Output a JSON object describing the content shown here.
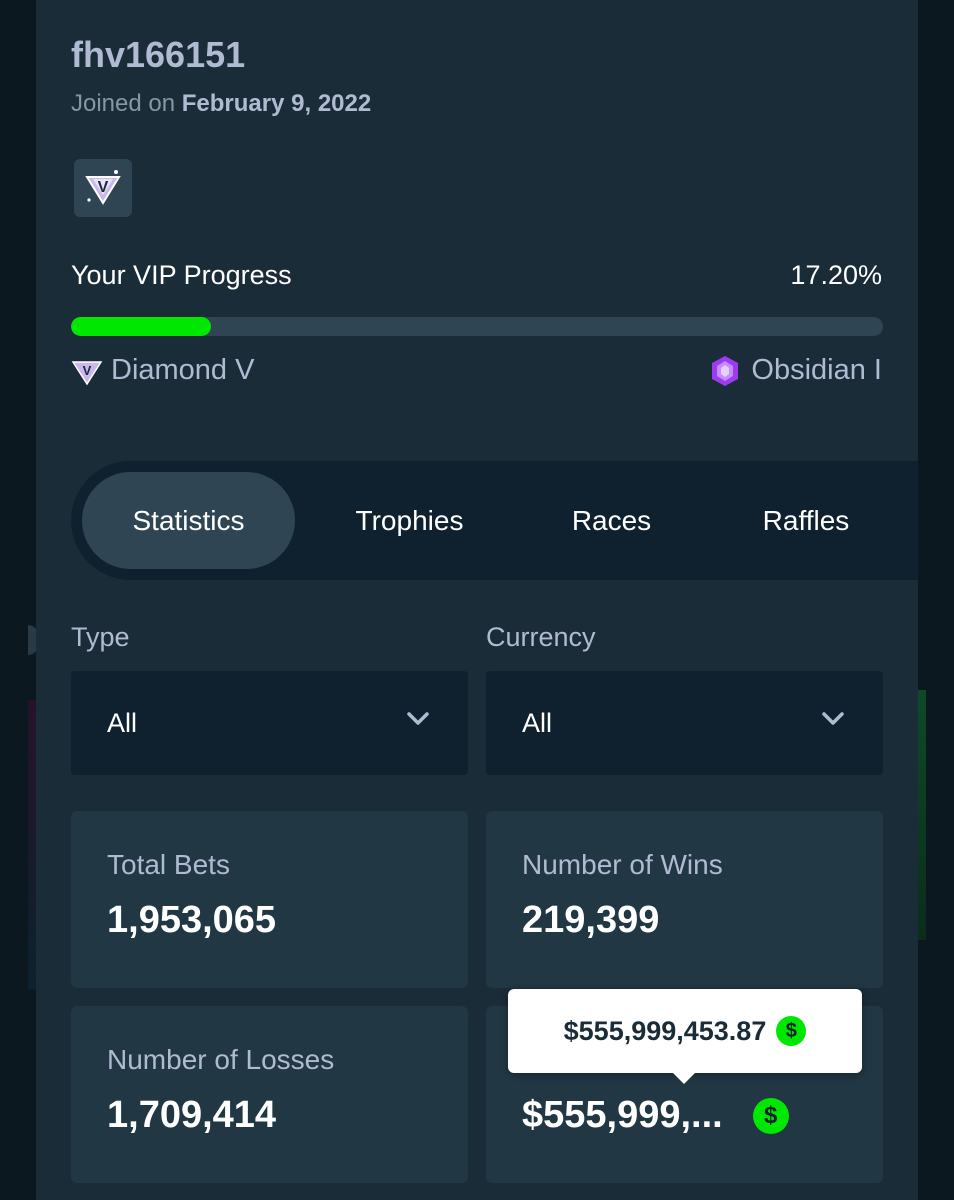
{
  "profile": {
    "username": "fhv166151",
    "joined_prefix": "Joined on",
    "joined_date": "February 9, 2022"
  },
  "badge": {
    "icon": "diamond-v-icon"
  },
  "vip": {
    "label": "Your VIP Progress",
    "percent_text": "17.20%",
    "progress_fraction": 0.172,
    "current_rank": "Diamond V",
    "next_rank": "Obsidian I",
    "progress_color": "#00e701"
  },
  "tabs": [
    {
      "label": "Statistics",
      "active": true
    },
    {
      "label": "Trophies",
      "active": false
    },
    {
      "label": "Races",
      "active": false
    },
    {
      "label": "Raffles",
      "active": false
    }
  ],
  "filters": {
    "type": {
      "label": "Type",
      "value": "All"
    },
    "currency": {
      "label": "Currency",
      "value": "All"
    }
  },
  "stats": {
    "total_bets": {
      "label": "Total Bets",
      "value": "1,953,065"
    },
    "wins": {
      "label": "Number of Wins",
      "value": "219,399"
    },
    "losses": {
      "label": "Number of Losses",
      "value": "1,709,414"
    },
    "wagered": {
      "value": "$555,999,...",
      "currency_symbol": "$"
    }
  },
  "tooltip": {
    "text": "$555,999,453.87",
    "currency_symbol": "$"
  }
}
